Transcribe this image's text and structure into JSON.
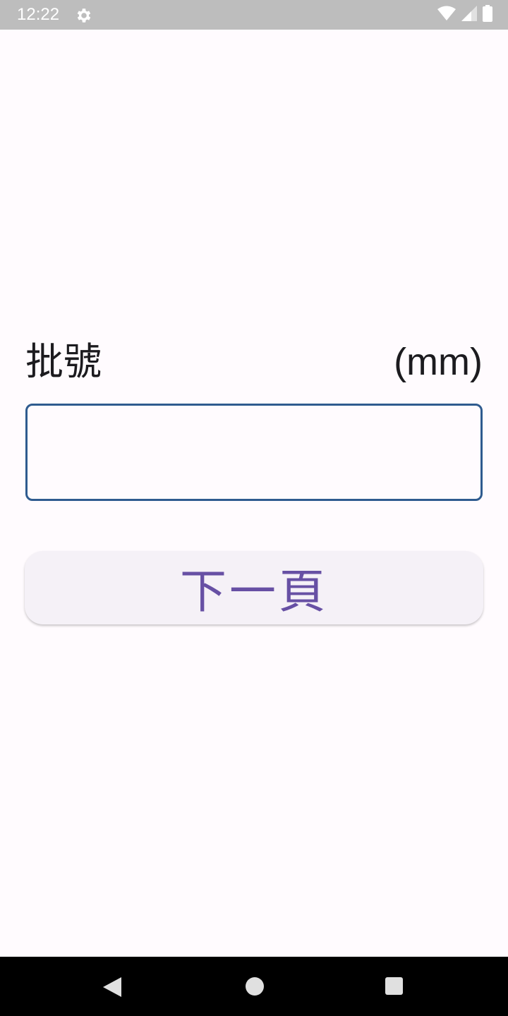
{
  "status_bar": {
    "time": "12:22",
    "icons": [
      "gear-icon",
      "wifi-icon",
      "signal-icon",
      "battery-icon"
    ]
  },
  "form": {
    "label": "批號",
    "unit": "(mm)",
    "input_value": "",
    "next_button_label": "下一頁"
  },
  "navigation_bar": {
    "icons": [
      "back-icon",
      "home-icon",
      "recents-icon"
    ]
  },
  "colors": {
    "background": "#fffbfe",
    "status_bar": "#bdbdbd",
    "field_border": "#2f5b8f",
    "button_background": "#f5f1f7",
    "button_text": "#6750a4",
    "nav_bar": "#000000"
  }
}
